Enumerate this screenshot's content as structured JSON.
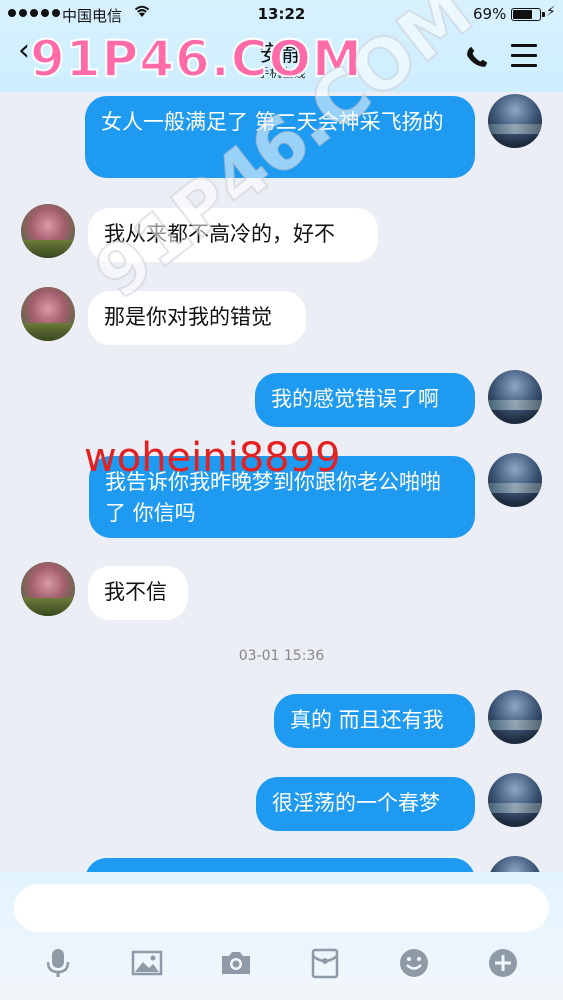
{
  "status_bar": {
    "carrier": "中国电信",
    "time": "13:22",
    "battery": "69%"
  },
  "header": {
    "title": "安静",
    "subtitle": "手机在线"
  },
  "watermarks": {
    "top": "91P46.COM",
    "diagonal": "91P46.COM",
    "red": "woheini8899"
  },
  "messages": [
    {
      "from": "me",
      "text": "女人一般满足了 第二天会神采飞扬的"
    },
    {
      "from": "other",
      "text": "我从来都不高冷的，好不"
    },
    {
      "from": "other",
      "text": "那是你对我的错觉"
    },
    {
      "from": "me",
      "text": "我的感觉错误了啊"
    },
    {
      "from": "me",
      "text": "我告诉你我昨晚梦到你跟你老公啪啪了 你信吗"
    },
    {
      "from": "other",
      "text": "我不信"
    },
    {
      "from": "me",
      "text": "真的 而且还有我"
    },
    {
      "from": "me",
      "text": "很淫荡的一个春梦"
    }
  ],
  "timestamp": "03-01 15:36",
  "toolbar": [
    "microphone-icon",
    "image-icon",
    "camera-icon",
    "red-packet-icon",
    "emoji-icon",
    "plus-icon"
  ]
}
